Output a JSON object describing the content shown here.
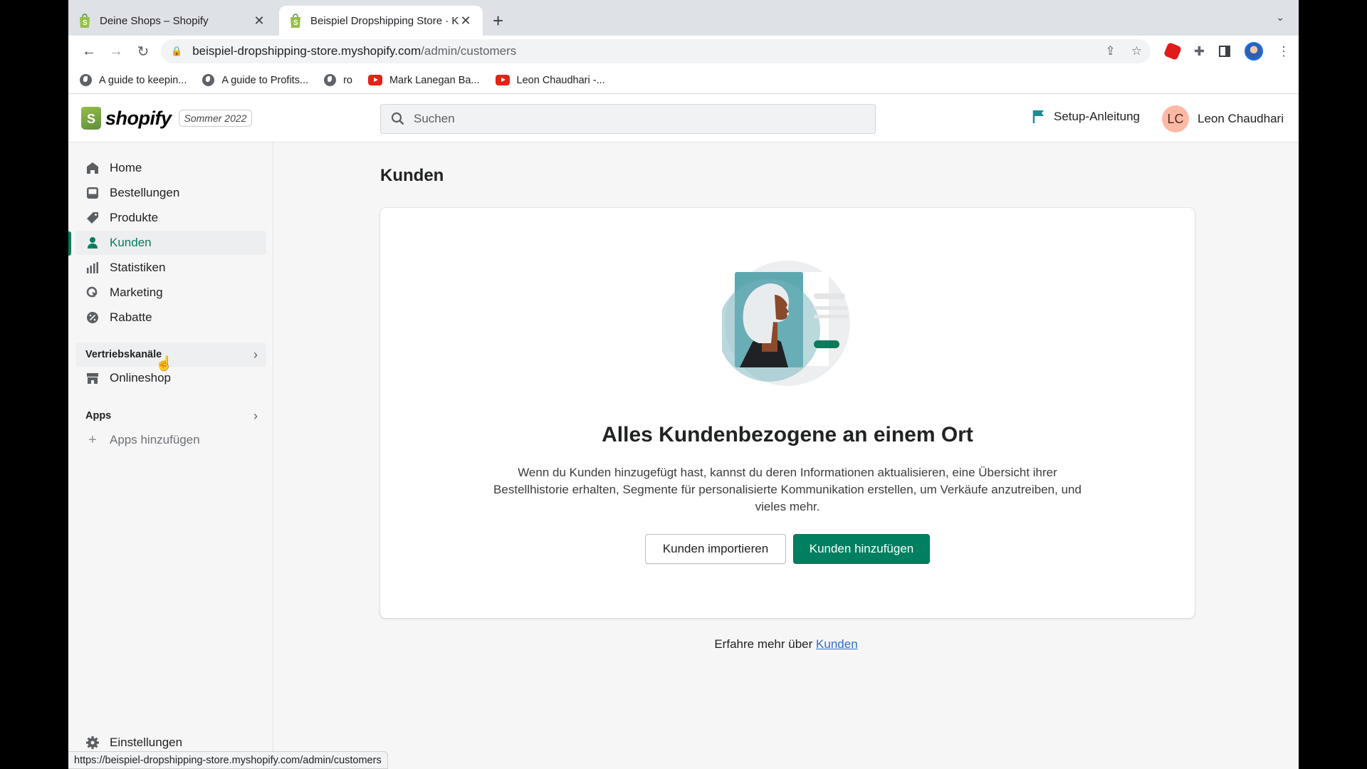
{
  "browser": {
    "tabs": [
      {
        "title": "Deine Shops – Shopify",
        "active": false
      },
      {
        "title": "Beispiel Dropshipping Store · K",
        "active": true
      }
    ],
    "new_tab_icon": "plus-icon",
    "url_host": "beispiel-dropshipping-store.myshopify.com",
    "url_path": "/admin/customers",
    "bookmarks": [
      {
        "label": "A guide to keepin...",
        "icon": "globe-icon"
      },
      {
        "label": "A guide to Profits...",
        "icon": "globe-icon"
      },
      {
        "label": "ro",
        "icon": "globe-icon"
      },
      {
        "label": "Mark Lanegan Ba...",
        "icon": "youtube-icon"
      },
      {
        "label": "Leon Chaudhari -...",
        "icon": "youtube-icon"
      }
    ],
    "status_url": "https://beispiel-dropshipping-store.myshopify.com/admin/customers"
  },
  "topbar": {
    "logo_text": "shopify",
    "edition_badge": "Sommer 2022",
    "search_placeholder": "Suchen",
    "setup_label": "Setup-Anleitung",
    "user_initials": "LC",
    "user_name": "Leon Chaudhari"
  },
  "sidebar": {
    "items": [
      {
        "label": "Home",
        "icon": "home-icon"
      },
      {
        "label": "Bestellungen",
        "icon": "orders-icon"
      },
      {
        "label": "Produkte",
        "icon": "tag-icon"
      },
      {
        "label": "Kunden",
        "icon": "person-icon",
        "active": true
      },
      {
        "label": "Statistiken",
        "icon": "bar-chart-icon"
      },
      {
        "label": "Marketing",
        "icon": "marketing-icon"
      },
      {
        "label": "Rabatte",
        "icon": "discount-icon"
      }
    ],
    "sales_channels_label": "Vertriebskanäle",
    "onlineshop_label": "Onlineshop",
    "apps_label": "Apps",
    "add_apps_label": "Apps hinzufügen",
    "settings_label": "Einstellungen"
  },
  "main": {
    "page_title": "Kunden",
    "empty_title": "Alles Kundenbezogene an einem Ort",
    "empty_text": "Wenn du Kunden hinzugefügt hast, kannst du deren Informationen aktualisieren, eine Übersicht ihrer Bestellhistorie erhalten, Segmente für personalisierte Kommunikation erstellen, um Verkäufe anzutreiben, und vieles mehr.",
    "import_button": "Kunden importieren",
    "add_button": "Kunden hinzufügen",
    "learn_more_prefix": "Erfahre mehr über",
    "learn_more_link": "Kunden"
  },
  "colors": {
    "primary": "#008060",
    "link": "#2c6ecb",
    "avatar_bg": "#feb9a4"
  }
}
